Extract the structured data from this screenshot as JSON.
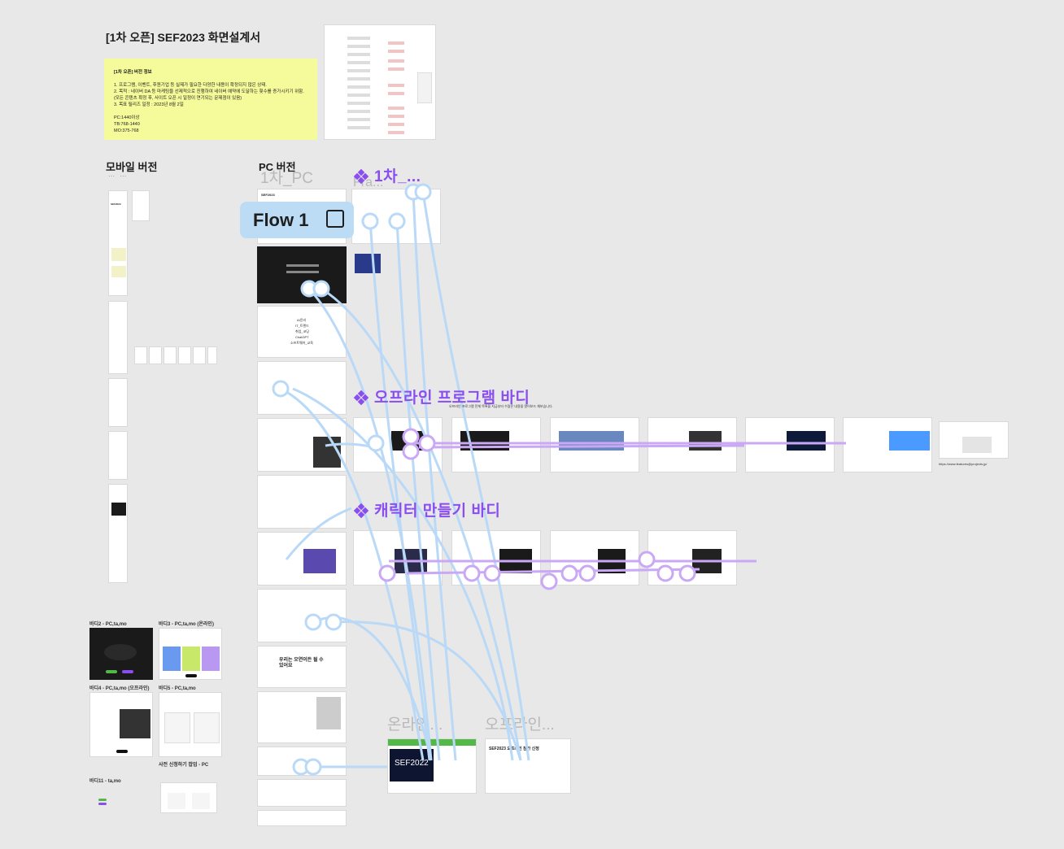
{
  "doc": {
    "title": "[1차 오픈] SEF2023 화면설계서"
  },
  "sticky": {
    "title": "[1차 오픈] 버전 정보",
    "line1": "1. 프로그램, 이벤트, 후원기업 등 실제가 필요한 다양한 내용이 확정되지 않은 상태.",
    "line2": "2. 목적 : 네이버 DA 등 마케팅을 선제적으로 진행하여 네이버 예약에 도달하는 횟수를 증가시키기 위함. (모든 콘텐츠 확정 후, 사이트 오픈 시 일정이 연기되는 문제점이 있음)",
    "line3": "3. 목표 릴리즈 일정 : 2023년 8월 2일",
    "pc": "PC:1440이상",
    "tb": "TB:768-1440",
    "mo": "MO:375-768"
  },
  "labels": {
    "mobile": "모바일 버전",
    "pc": "PC 버전",
    "pc_ghost": "1차_PC",
    "fra_ghost": "Fra...",
    "flow": "Flow 1",
    "sec1": "1차_...",
    "sec2": "오프라인 프로그램 바디",
    "sec3": "캐릭터 만들기 바디",
    "online_ghost": "온라인...",
    "offline_ghost": "오프라인...",
    "dots": "⋯ ⋯"
  },
  "frames": {
    "body2": "바디2 - PC,ta,mo",
    "body3": "바디3 - PC,ta,mo (온라인)",
    "body4": "바디4 - PC,ta,mo (오프라인)",
    "body5": "바디5 - PC,ta,mo",
    "popup": "사전 신청하기 팝업 - PC",
    "body11": "바디11 - ta,mo",
    "offline_apply_title": "SEF2023 오프라인 참가 신청",
    "url": "https://www.features@projects.jp/",
    "sef2022": "SEF2022",
    "sef2023": "SEF2023",
    "hero_text": "우리는 오연이든 될 수 있어요",
    "list_ai": "AI윤리",
    "list_it": "IT_트렌드",
    "list_career": "취업_코딩",
    "list_chatgpt": "ChatGPT",
    "list_soft": "소프트웨어_교육",
    "offline_desc": "오프라인 프로그램 전체 목록을 지금부터 수많은 내용을 열어보드 채보습니다."
  },
  "colors": {
    "accent_purple": "#8a4df0",
    "flow_blue": "#bcdcf5",
    "connector_blue": "#b9d9f7",
    "sticky_yellow": "#f5fa9a",
    "pink_note": "#e040a0",
    "green": "#53b848"
  }
}
